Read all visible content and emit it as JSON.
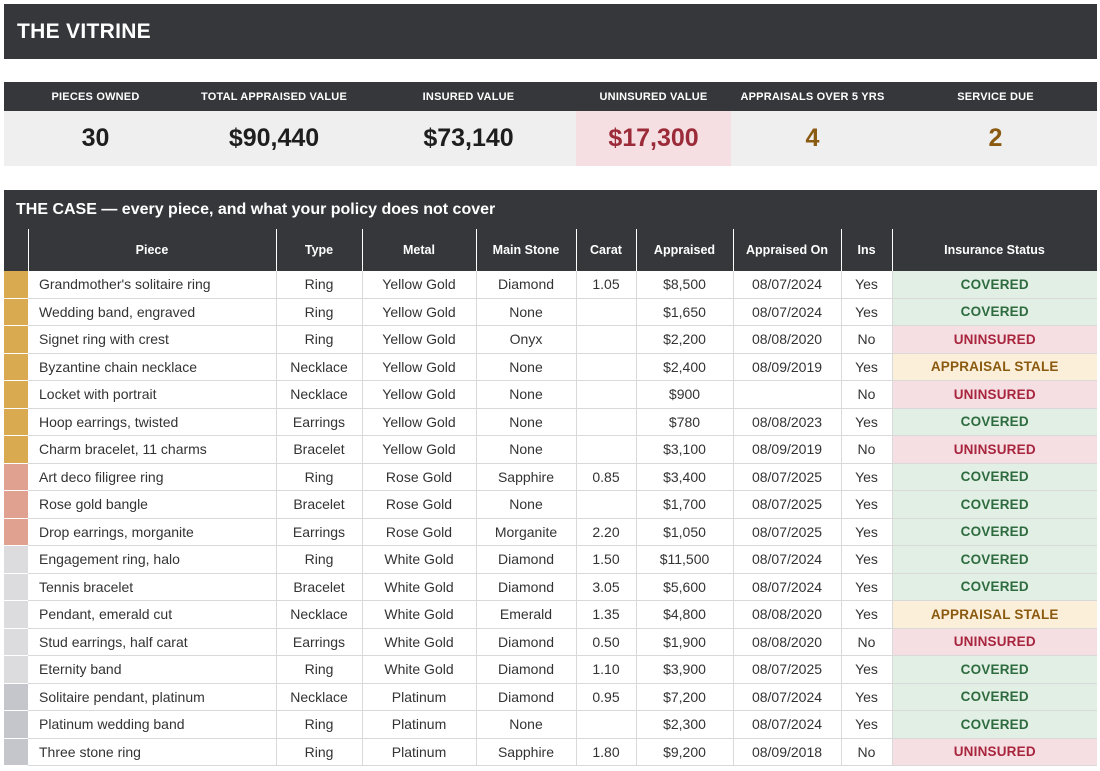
{
  "app": {
    "title": "THE VITRINE"
  },
  "kpis": [
    {
      "label": "PIECES OWNED",
      "value": "30",
      "tone": "normal"
    },
    {
      "label": "TOTAL APPRAISED VALUE",
      "value": "$90,440",
      "tone": "normal"
    },
    {
      "label": "INSURED VALUE",
      "value": "$73,140",
      "tone": "normal"
    },
    {
      "label": "UNINSURED VALUE",
      "value": "$17,300",
      "tone": "alert"
    },
    {
      "label": "APPRAISALS OVER 5 YRS",
      "value": "4",
      "tone": "warn"
    },
    {
      "label": "SERVICE DUE",
      "value": "2",
      "tone": "warn"
    }
  ],
  "case": {
    "title": "THE CASE — every piece, and what your policy does not cover",
    "columns": [
      "",
      "Piece",
      "Type",
      "Metal",
      "Main Stone",
      "Carat",
      "Appraised",
      "Appraised On",
      "Ins",
      "Insurance Status"
    ],
    "metal_colors": {
      "Yellow Gold": "#d9aa4f",
      "Rose Gold": "#e0a190",
      "White Gold": "#dcdcdf",
      "Platinum": "#c4c6cb"
    },
    "status_colors": {
      "COVERED": "#e2efe5",
      "UNINSURED": "#f6dfe2",
      "APPRAISAL STALE": "#fbefd9"
    },
    "rows": [
      {
        "piece": "Grandmother's solitaire ring",
        "type": "Ring",
        "metal": "Yellow Gold",
        "stone": "Diamond",
        "carat": "1.05",
        "appraised": "$8,500",
        "date": "08/07/2024",
        "ins": "Yes",
        "status": "COVERED"
      },
      {
        "piece": "Wedding band, engraved",
        "type": "Ring",
        "metal": "Yellow Gold",
        "stone": "None",
        "carat": "",
        "appraised": "$1,650",
        "date": "08/07/2024",
        "ins": "Yes",
        "status": "COVERED"
      },
      {
        "piece": "Signet ring with crest",
        "type": "Ring",
        "metal": "Yellow Gold",
        "stone": "Onyx",
        "carat": "",
        "appraised": "$2,200",
        "date": "08/08/2020",
        "ins": "No",
        "status": "UNINSURED"
      },
      {
        "piece": "Byzantine chain necklace",
        "type": "Necklace",
        "metal": "Yellow Gold",
        "stone": "None",
        "carat": "",
        "appraised": "$2,400",
        "date": "08/09/2019",
        "ins": "Yes",
        "status": "APPRAISAL STALE"
      },
      {
        "piece": "Locket with portrait",
        "type": "Necklace",
        "metal": "Yellow Gold",
        "stone": "None",
        "carat": "",
        "appraised": "$900",
        "date": "",
        "ins": "No",
        "status": "UNINSURED"
      },
      {
        "piece": "Hoop earrings, twisted",
        "type": "Earrings",
        "metal": "Yellow Gold",
        "stone": "None",
        "carat": "",
        "appraised": "$780",
        "date": "08/08/2023",
        "ins": "Yes",
        "status": "COVERED"
      },
      {
        "piece": "Charm bracelet, 11 charms",
        "type": "Bracelet",
        "metal": "Yellow Gold",
        "stone": "None",
        "carat": "",
        "appraised": "$3,100",
        "date": "08/09/2019",
        "ins": "No",
        "status": "UNINSURED"
      },
      {
        "piece": "Art deco filigree ring",
        "type": "Ring",
        "metal": "Rose Gold",
        "stone": "Sapphire",
        "carat": "0.85",
        "appraised": "$3,400",
        "date": "08/07/2025",
        "ins": "Yes",
        "status": "COVERED"
      },
      {
        "piece": "Rose gold bangle",
        "type": "Bracelet",
        "metal": "Rose Gold",
        "stone": "None",
        "carat": "",
        "appraised": "$1,700",
        "date": "08/07/2025",
        "ins": "Yes",
        "status": "COVERED"
      },
      {
        "piece": "Drop earrings, morganite",
        "type": "Earrings",
        "metal": "Rose Gold",
        "stone": "Morganite",
        "carat": "2.20",
        "appraised": "$1,050",
        "date": "08/07/2025",
        "ins": "Yes",
        "status": "COVERED"
      },
      {
        "piece": "Engagement ring, halo",
        "type": "Ring",
        "metal": "White Gold",
        "stone": "Diamond",
        "carat": "1.50",
        "appraised": "$11,500",
        "date": "08/07/2024",
        "ins": "Yes",
        "status": "COVERED"
      },
      {
        "piece": "Tennis bracelet",
        "type": "Bracelet",
        "metal": "White Gold",
        "stone": "Diamond",
        "carat": "3.05",
        "appraised": "$5,600",
        "date": "08/07/2024",
        "ins": "Yes",
        "status": "COVERED"
      },
      {
        "piece": "Pendant, emerald cut",
        "type": "Necklace",
        "metal": "White Gold",
        "stone": "Emerald",
        "carat": "1.35",
        "appraised": "$4,800",
        "date": "08/08/2020",
        "ins": "Yes",
        "status": "APPRAISAL STALE"
      },
      {
        "piece": "Stud earrings, half carat",
        "type": "Earrings",
        "metal": "White Gold",
        "stone": "Diamond",
        "carat": "0.50",
        "appraised": "$1,900",
        "date": "08/08/2020",
        "ins": "No",
        "status": "UNINSURED"
      },
      {
        "piece": "Eternity band",
        "type": "Ring",
        "metal": "White Gold",
        "stone": "Diamond",
        "carat": "1.10",
        "appraised": "$3,900",
        "date": "08/07/2025",
        "ins": "Yes",
        "status": "COVERED"
      },
      {
        "piece": "Solitaire pendant, platinum",
        "type": "Necklace",
        "metal": "Platinum",
        "stone": "Diamond",
        "carat": "0.95",
        "appraised": "$7,200",
        "date": "08/07/2024",
        "ins": "Yes",
        "status": "COVERED"
      },
      {
        "piece": "Platinum wedding band",
        "type": "Ring",
        "metal": "Platinum",
        "stone": "None",
        "carat": "",
        "appraised": "$2,300",
        "date": "08/07/2024",
        "ins": "Yes",
        "status": "COVERED"
      },
      {
        "piece": "Three stone ring",
        "type": "Ring",
        "metal": "Platinum",
        "stone": "Sapphire",
        "carat": "1.80",
        "appraised": "$9,200",
        "date": "08/09/2018",
        "ins": "No",
        "status": "UNINSURED"
      }
    ]
  }
}
